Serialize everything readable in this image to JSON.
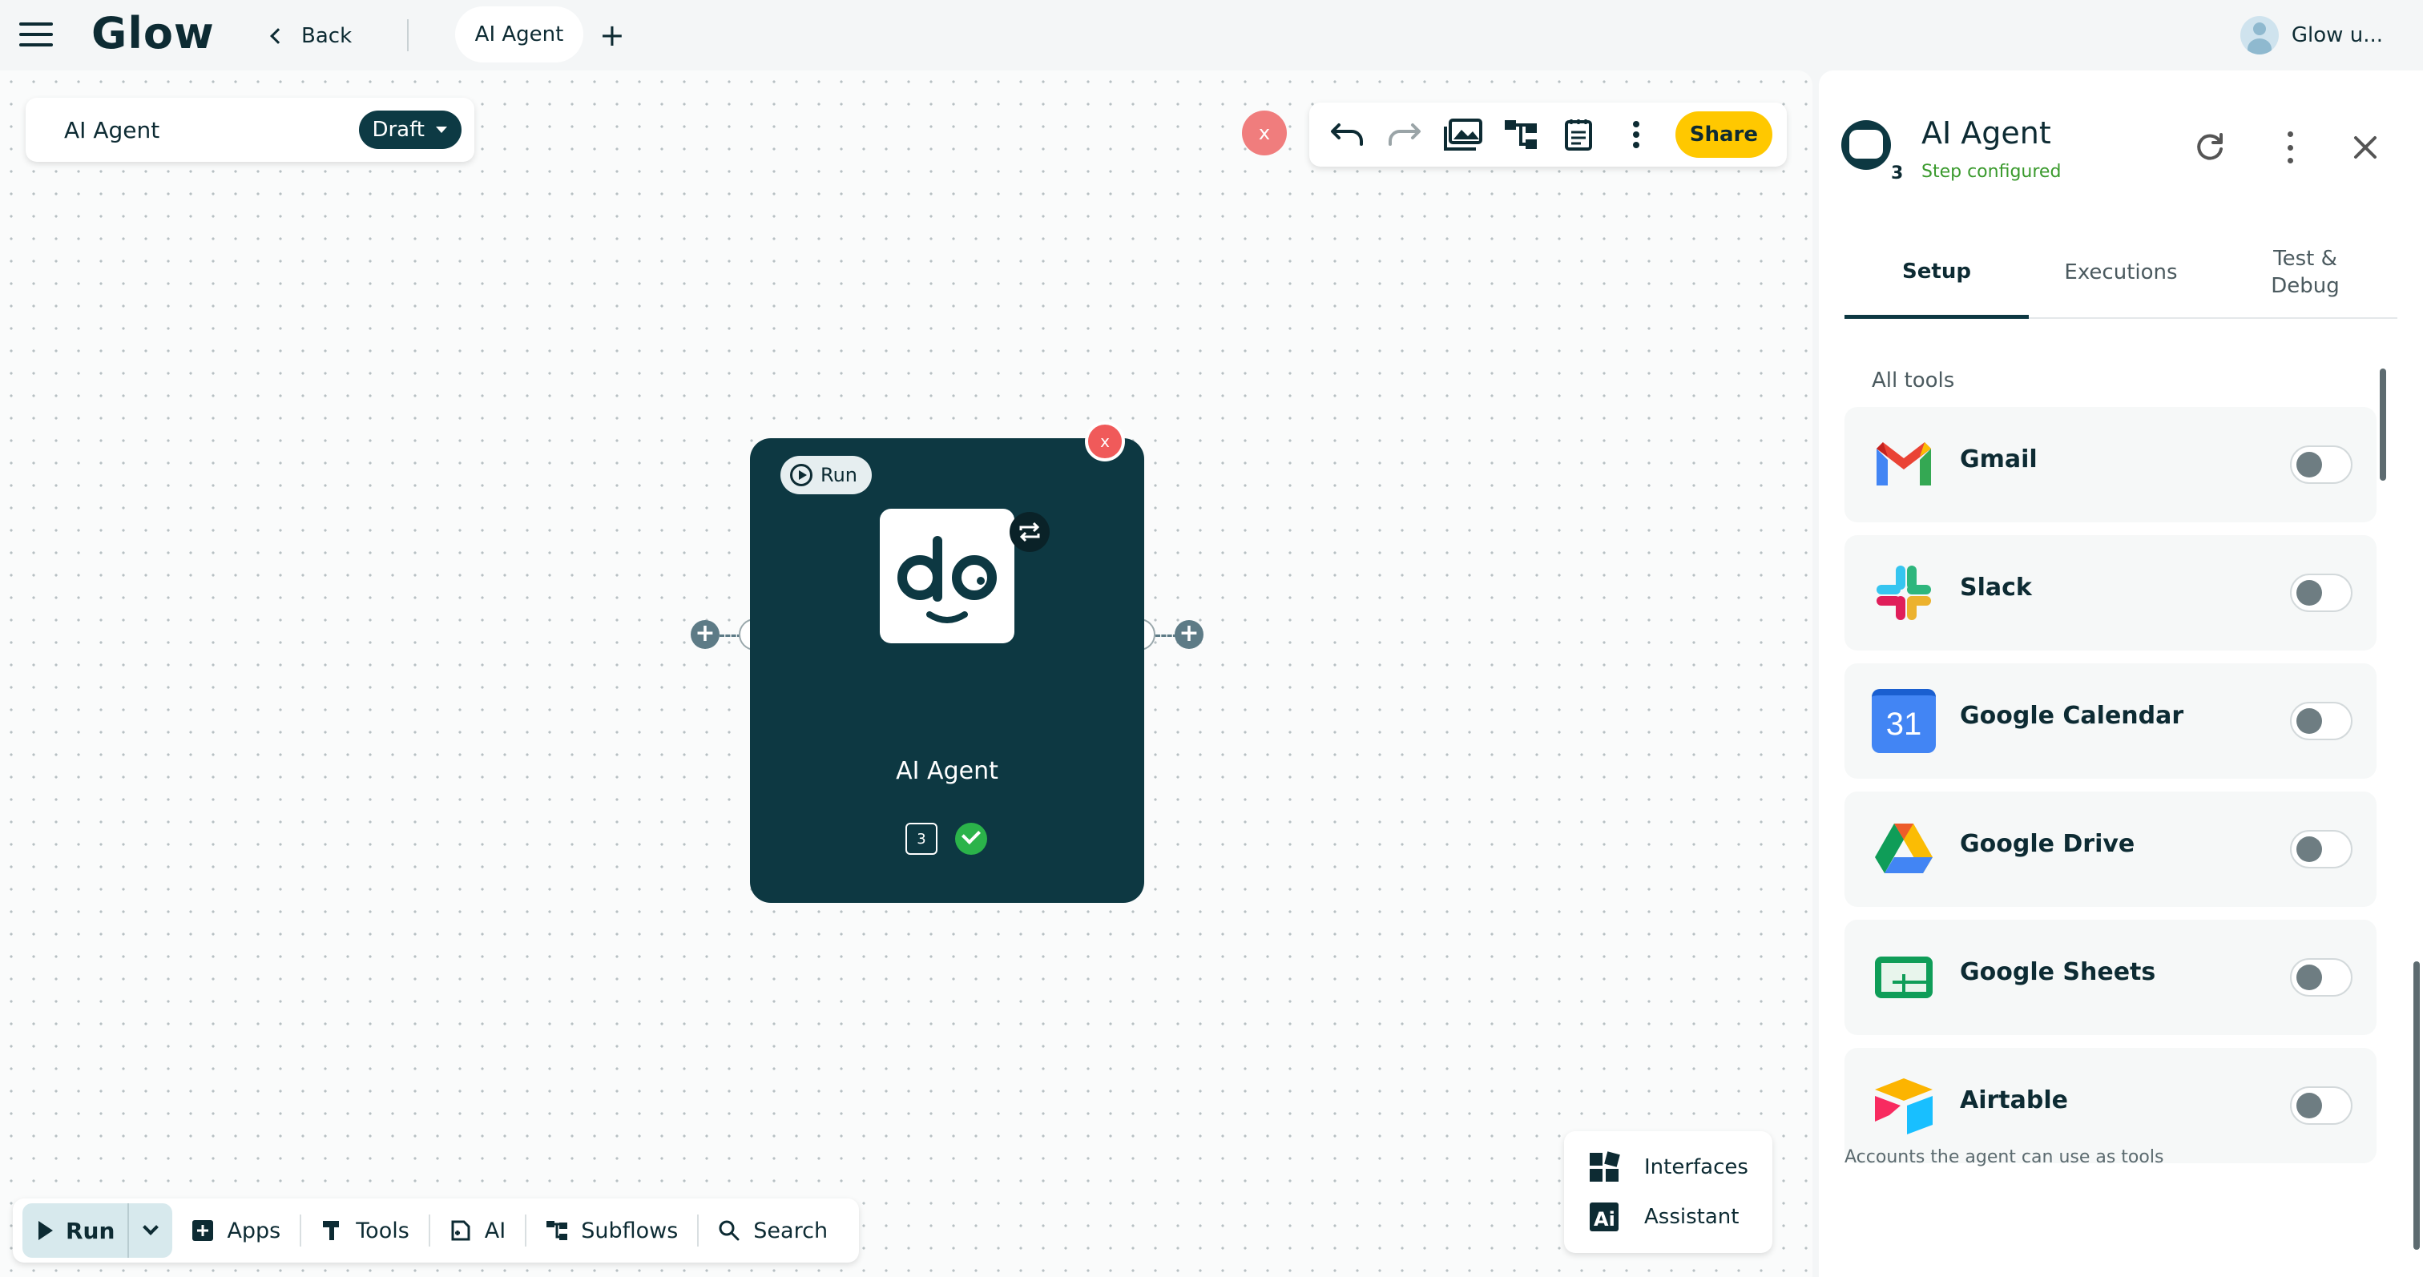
{
  "app": {
    "logo": "Glow"
  },
  "header": {
    "back_label": "Back",
    "active_tab": "AI Agent",
    "add_tab": "+",
    "user_name": "Glow u..."
  },
  "canvas": {
    "flow_name": "AI Agent",
    "status_label": "Draft",
    "close_label": "x",
    "toolbar": {
      "share_label": "Share"
    },
    "node": {
      "run_label": "Run",
      "title": "AI Agent",
      "count": "3",
      "close_label": "x"
    },
    "bottom_bar": {
      "run_label": "Run",
      "items": [
        {
          "label": "Apps",
          "icon": "plus-square-icon"
        },
        {
          "label": "Tools",
          "icon": "hammer-icon"
        },
        {
          "label": "AI",
          "icon": "ai-file-icon"
        },
        {
          "label": "Subflows",
          "icon": "hierarchy-icon"
        },
        {
          "label": "Search",
          "icon": "search-icon"
        }
      ]
    },
    "side_menu": {
      "items": [
        {
          "label": "Interfaces",
          "icon": "interfaces-icon"
        },
        {
          "label": "Assistant",
          "icon": "assistant-icon"
        }
      ]
    }
  },
  "panel": {
    "title": "AI Agent",
    "count": "3",
    "status": "Step configured",
    "tabs": [
      "Setup",
      "Executions",
      "Test & Debug"
    ],
    "active_tab": "Setup",
    "tools_label": "All tools",
    "tools": [
      {
        "name": "Gmail",
        "enabled": false
      },
      {
        "name": "Slack",
        "enabled": false
      },
      {
        "name": "Google Calendar",
        "enabled": false
      },
      {
        "name": "Google Drive",
        "enabled": false
      },
      {
        "name": "Google Sheets",
        "enabled": false
      },
      {
        "name": "Airtable",
        "enabled": false
      }
    ],
    "footer_note": "Accounts the agent can use as tools",
    "calendar_day": "31"
  },
  "colors": {
    "node_bg": "#0d3842",
    "share": "#ffc800",
    "close_red": "#f07d7d",
    "status_green": "#3a9a2d"
  }
}
